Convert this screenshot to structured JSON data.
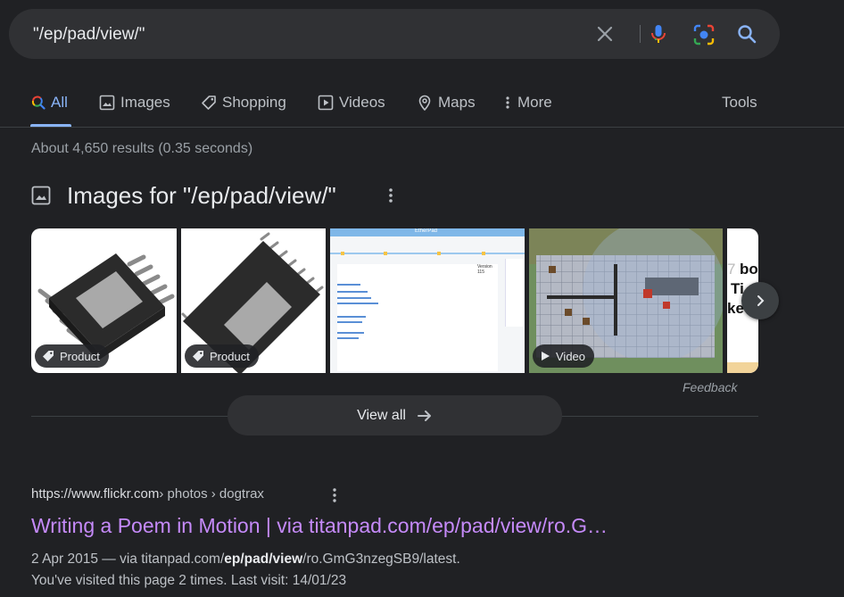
{
  "search": {
    "query": "\"/ep/pad/view/\""
  },
  "tabs": [
    {
      "label": "All",
      "active": true
    },
    {
      "label": "Images"
    },
    {
      "label": "Shopping"
    },
    {
      "label": "Videos"
    },
    {
      "label": "Maps"
    },
    {
      "label": "More"
    }
  ],
  "tools_label": "Tools",
  "stats": "About 4,650 results (0.35 seconds)",
  "images_section": {
    "title": "Images for \"/ep/pad/view/\"",
    "thumbnails": [
      {
        "badge": "Product",
        "badge_icon": "tag-icon"
      },
      {
        "badge": "Product",
        "badge_icon": "tag-icon"
      },
      {
        "header_text": "EtherPad",
        "caption": "Version 115"
      },
      {
        "badge": "Video",
        "badge_icon": "play-icon"
      },
      {
        "partial_text": "bo",
        "partial_text_2": "Ti",
        "partial_text_3": "ke"
      }
    ],
    "feedback": "Feedback",
    "view_all": "View all"
  },
  "result": {
    "site": "https://www.flickr.com",
    "path": " › photos › dogtrax",
    "title": "Writing a Poem in Motion | via titanpad.com/ep/pad/view/ro.G…",
    "snippet_date": "2 Apr 2015",
    "snippet_sep": " — via titanpad.com/",
    "snippet_bold": "ep/pad/view",
    "snippet_tail": "/ro.GmG3nzegSB9/latest.",
    "visited": "You've visited this page 2 times. Last visit: 14/01/23"
  },
  "colors": {
    "background": "#202124",
    "accent": "#8ab4f8",
    "visited_link": "#c58af9",
    "surface": "#303134"
  }
}
